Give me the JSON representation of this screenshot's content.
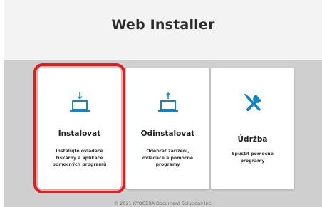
{
  "header": {
    "title": "Web Installer"
  },
  "cards": [
    {
      "icon": "laptop-download-icon",
      "title": "Instalovat",
      "desc": [
        "Instalujte ovladače",
        "tiskárny a aplikace",
        "pomocných programů"
      ],
      "selected": true
    },
    {
      "icon": "laptop-upload-icon",
      "title": "Odinstalovat",
      "desc": [
        "Odebrat zařízení,",
        "ovladače a pomocné",
        "programy"
      ],
      "selected": false
    },
    {
      "icon": "tools-icon",
      "title": "Údržba",
      "desc": [
        "Spustit pomocné",
        "programy"
      ],
      "selected": false
    }
  ],
  "footer": {
    "text": "© 2021 KYOCERA Document Solutions Inc."
  },
  "colors": {
    "accent": "#0f86c5",
    "highlight": "#e11d1d",
    "background": "#cfcfcf"
  }
}
